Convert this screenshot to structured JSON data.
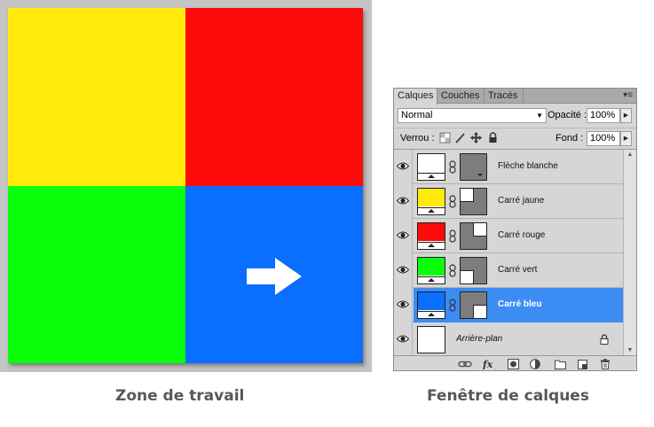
{
  "work_area": {
    "caption": "Zone de travail",
    "colors": {
      "yellow": "#ffea0a",
      "red": "#ff0a0a",
      "green": "#0aff0a",
      "blue": "#0a6eff",
      "arrow": "#ffffff"
    }
  },
  "layers_panel": {
    "caption": "Fenêtre de calques",
    "tabs": [
      {
        "label": "Calques",
        "active": true
      },
      {
        "label": "Couches",
        "active": false
      },
      {
        "label": "Tracés",
        "active": false
      }
    ],
    "blend_mode": "Normal",
    "opacity_label": "Opacité :",
    "opacity_value": "100%",
    "lock_label": "Verrou :",
    "fill_label": "Fond :",
    "fill_value": "100%",
    "layers": [
      {
        "name": "Flèche blanche",
        "thumb_color": "#ffffff",
        "selected": false
      },
      {
        "name": "Carré jaune",
        "thumb_color": "#ffea0a",
        "selected": false
      },
      {
        "name": "Carré rouge",
        "thumb_color": "#ff0a0a",
        "selected": false
      },
      {
        "name": "Carré vert",
        "thumb_color": "#0aff0a",
        "selected": false
      },
      {
        "name": "Carré bleu",
        "thumb_color": "#0a6eff",
        "selected": true
      }
    ],
    "background_layer": {
      "name": "Arrière-plan",
      "locked": true
    },
    "selection_color": "#3b8cf3",
    "footer_icons": [
      "link-layers-icon",
      "fx-icon",
      "add-mask-icon",
      "adjustment-layer-icon",
      "new-group-icon",
      "new-layer-icon",
      "trash-icon"
    ]
  }
}
